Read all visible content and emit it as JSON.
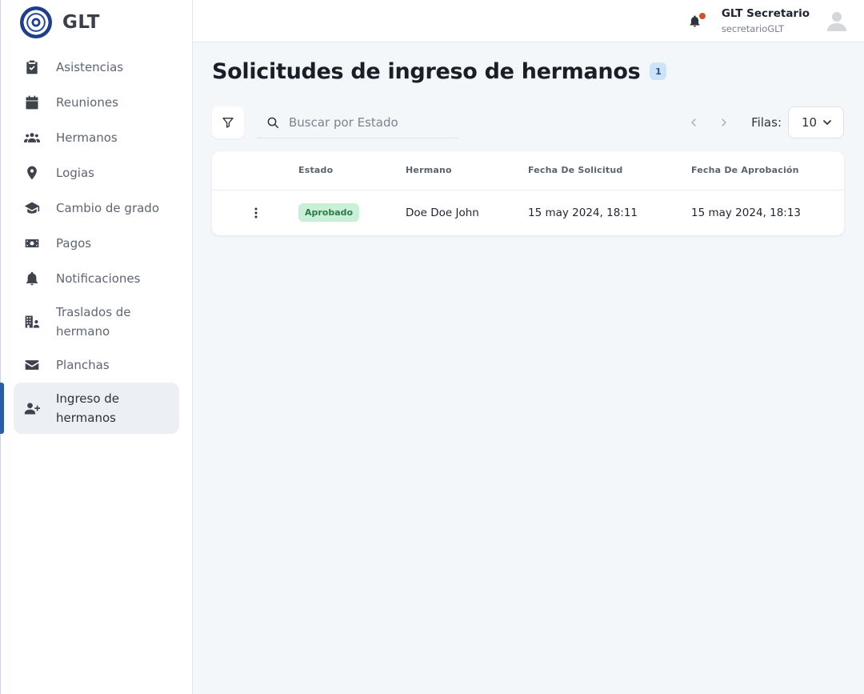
{
  "brand": {
    "name": "GLT"
  },
  "sidebar": {
    "items": [
      {
        "label": "Asistencias",
        "icon": "clipboard-check-icon"
      },
      {
        "label": "Reuniones",
        "icon": "calendar-icon"
      },
      {
        "label": "Hermanos",
        "icon": "users-icon"
      },
      {
        "label": "Logias",
        "icon": "map-pin-icon"
      },
      {
        "label": "Cambio de grado",
        "icon": "graduation-cap-icon"
      },
      {
        "label": "Pagos",
        "icon": "money-bill-icon"
      },
      {
        "label": "Notificaciones",
        "icon": "bell-icon"
      },
      {
        "label": "Traslados de hermano",
        "icon": "building-user-icon"
      },
      {
        "label": "Planchas",
        "icon": "envelope-icon"
      },
      {
        "label": "Ingreso de hermanos",
        "icon": "user-plus-icon",
        "active": true
      }
    ]
  },
  "header": {
    "user_name": "GLT Secretario",
    "user_handle": "secretarioGLT",
    "notification_dot_color": "#c8562a"
  },
  "page": {
    "title": "Solicitudes de ingreso de hermanos",
    "count": "1"
  },
  "toolbar": {
    "search_placeholder": "Buscar por Estado",
    "rows_label": "Filas:",
    "rows_value": "10"
  },
  "table": {
    "columns": [
      "Estado",
      "Hermano",
      "Fecha De Solicitud",
      "Fecha De Aprobación"
    ],
    "rows": [
      {
        "estado": "Aprobado",
        "hermano": "Doe Doe John",
        "fecha_solicitud": "15 may 2024, 18:11",
        "fecha_aprobacion": "15 may 2024, 18:13"
      }
    ]
  },
  "colors": {
    "accent": "#2a5ea8",
    "status_approved_bg": "#c9efd6",
    "status_approved_text": "#2b7a48",
    "badge_bg": "#cfe3f8"
  }
}
